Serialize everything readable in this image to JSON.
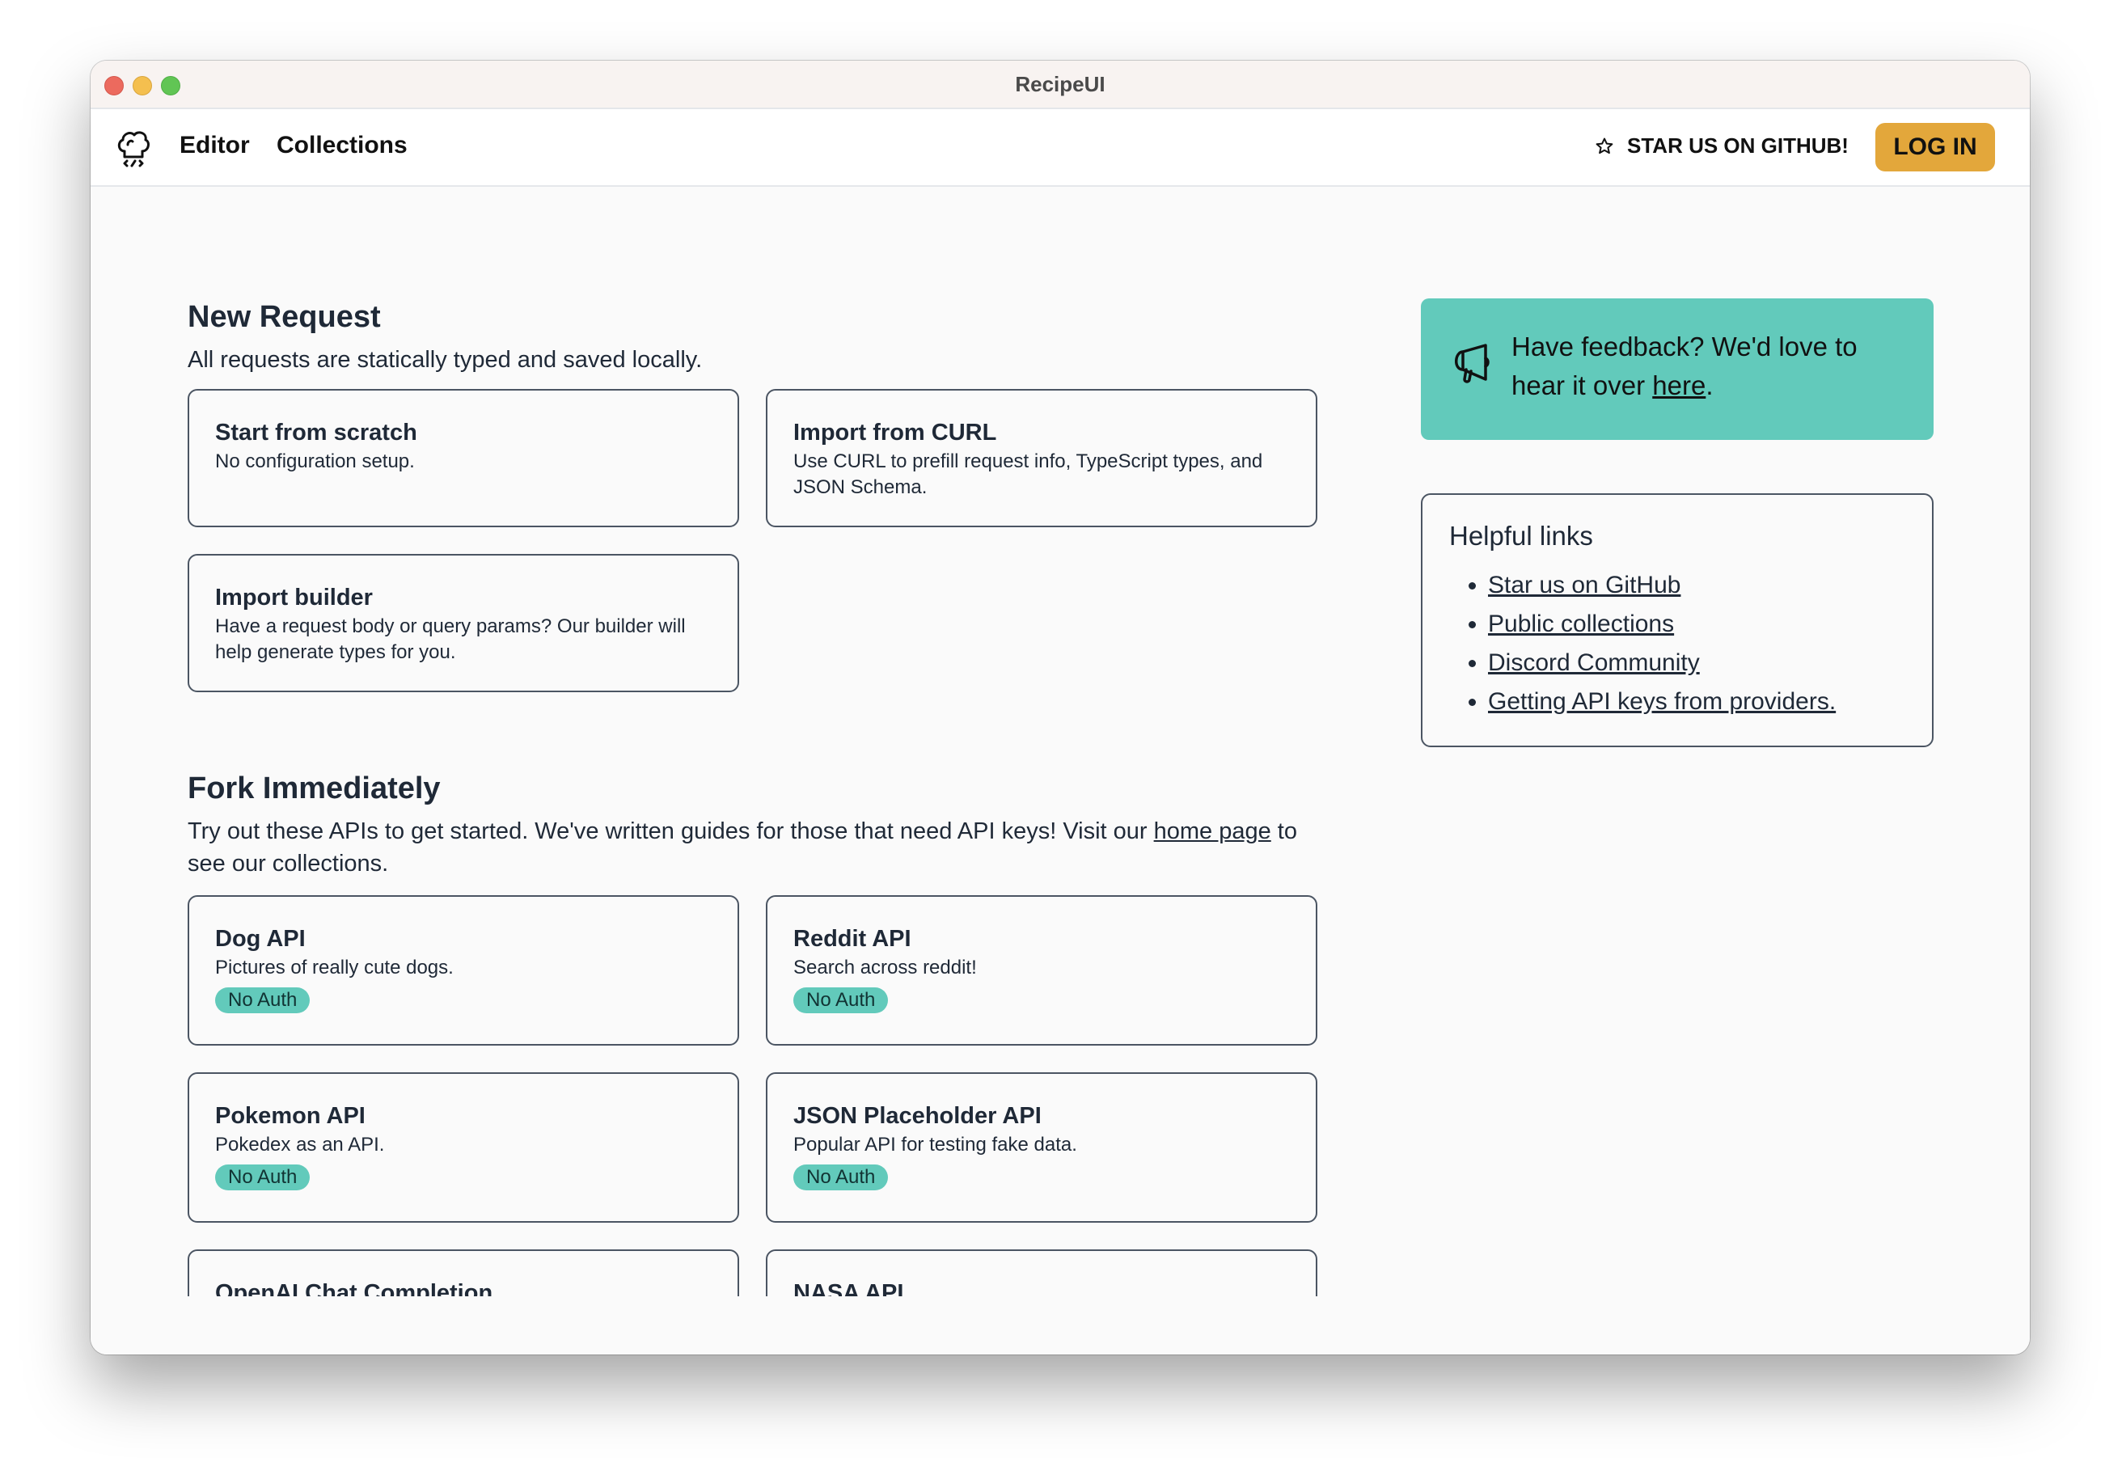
{
  "window": {
    "title": "RecipeUI"
  },
  "nav": {
    "logo_icon": "chef-hat-code-icon",
    "editor": "Editor",
    "collections": "Collections",
    "star_icon": "star-outline-icon",
    "star_label": "STAR US ON GITHUB!",
    "login_label": "LOG IN",
    "login_color": "#e3a73b"
  },
  "new_request": {
    "title": "New Request",
    "subtitle": "All requests are statically typed and saved locally.",
    "cards": [
      {
        "title": "Start from scratch",
        "desc": "No configuration setup."
      },
      {
        "title": "Import from CURL",
        "desc": "Use CURL to prefill request info, TypeScript types, and JSON Schema."
      },
      {
        "title": "Import builder",
        "desc": "Have a request body or query params? Our builder will help generate types for you."
      }
    ]
  },
  "fork": {
    "title": "Fork Immediately",
    "desc_before": "Try out these APIs to get started. We've written guides for those that need API keys! Visit our ",
    "desc_link": "home page",
    "desc_after": " to see our collections.",
    "cards": [
      {
        "title": "Dog API",
        "desc": "Pictures of really cute dogs.",
        "badge": "No Auth"
      },
      {
        "title": "Reddit API",
        "desc": "Search across reddit!",
        "badge": "No Auth"
      },
      {
        "title": "Pokemon API",
        "desc": "Pokedex as an API.",
        "badge": "No Auth"
      },
      {
        "title": "JSON Placeholder API",
        "desc": "Popular API for testing fake data.",
        "badge": "No Auth"
      },
      {
        "title": "OpenAI Chat Completion"
      },
      {
        "title": "NASA API"
      }
    ],
    "badge_color": "#62cabb"
  },
  "feedback": {
    "icon": "megaphone-icon",
    "text_before": "Have feedback? We'd love to hear it over ",
    "link": "here",
    "text_after": ".",
    "bg_color": "#62cabb"
  },
  "helpful_links": {
    "title": "Helpful links",
    "items": [
      "Star us on GitHub",
      "Public collections",
      "Discord Community",
      "Getting API keys from providers."
    ]
  }
}
